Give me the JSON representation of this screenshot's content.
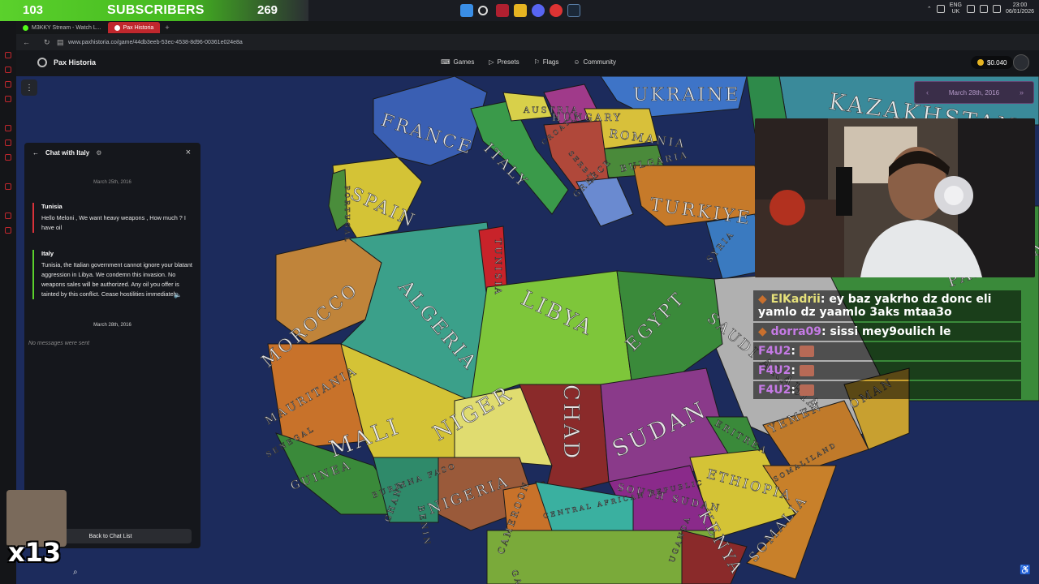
{
  "overlay": {
    "sub_count_left": "103",
    "sub_label": "SUBSCRIBERS",
    "sub_count_right": "269",
    "emote_counter": "x13"
  },
  "system_tray": {
    "lang_top": "ENG",
    "lang_bottom": "UK",
    "time": "23:00",
    "date": "06/01/2026"
  },
  "browser": {
    "tabs": [
      {
        "label": "M3KKY Stream - Watch L...",
        "active": false
      },
      {
        "label": "Pax Historia",
        "active": true
      }
    ],
    "url": "www.paxhistoria.co/game/44db3eeb-53ec-4538-8d96-00361e024e8a"
  },
  "app": {
    "name": "Pax Historia",
    "nav": [
      {
        "label": "Games",
        "icon": "gamepad-icon"
      },
      {
        "label": "Presets",
        "icon": "play-icon"
      },
      {
        "label": "Flags",
        "icon": "flag-icon"
      },
      {
        "label": "Community",
        "icon": "people-icon"
      }
    ],
    "balance": "$0.040"
  },
  "date_widget": {
    "label": "March 28th, 2016"
  },
  "chat": {
    "title": "Chat with Italy",
    "dates": [
      "March 25th, 2016",
      "March 28th, 2016"
    ],
    "messages": [
      {
        "sender": "Tunisia",
        "text": "Hello Meloni , We want heavy weapons , How much ? I have oil",
        "color": "#d9323a"
      },
      {
        "sender": "Italy",
        "text": "Tunisia, the Italian government cannot ignore your blatant aggression in Libya. We condemn this invasion. No weapons sales will be authorized. Any oil you offer is tainted by this conflict. Cease hostilities immediately.",
        "color": "#5bd12c"
      }
    ],
    "empty_text": "No messages were sent",
    "back_label": "Back to Chat List"
  },
  "map": {
    "labels": [
      "FRANCE",
      "SPAIN",
      "PORTUGAL",
      "ITALY",
      "AUSTRIA",
      "HUNGARY",
      "UKRAINE",
      "ROMANIA",
      "BULGARIA",
      "SERBIA",
      "CROATIA",
      "GREECE",
      "TURKIYE",
      "KAZAKHSTAN",
      "SYRIA",
      "TUNISIA",
      "MOROCCO",
      "ALGERIA",
      "LIBYA",
      "EGYPT",
      "SAUDI ARABIA",
      "MAURITANIA",
      "MALI",
      "NIGER",
      "CHAD",
      "SUDAN",
      "ERITREA",
      "SOUTH SUDAN",
      "ETHIOPIA",
      "SOMALIA",
      "YEMEN",
      "OMAN",
      "NIGERIA",
      "GUINEA",
      "SENEGAL",
      "GHANA",
      "BURKINA FASO",
      "CAMEROON",
      "CENTRAL AFRICAN REPUBLIC",
      "KENYA",
      "GABON",
      "UGANDA",
      "SOMALILAND",
      "PAKISTAN",
      "BENIN"
    ]
  },
  "stream_chat": [
    {
      "user": "ElKadrii",
      "text": ": ey baz yakrho dz donc eli yamlo dz yaamlo 3aks mtaa3o",
      "style": "y"
    },
    {
      "user": "dorra09",
      "text": ": sissi mey9oulich le",
      "style": "p"
    },
    {
      "user": "F4U2",
      "text": ":",
      "style": "p",
      "emote": true
    },
    {
      "user": "F4U2",
      "text": ":",
      "style": "p",
      "emote": true
    },
    {
      "user": "F4U2",
      "text": ":",
      "style": "p",
      "emote": true
    }
  ]
}
